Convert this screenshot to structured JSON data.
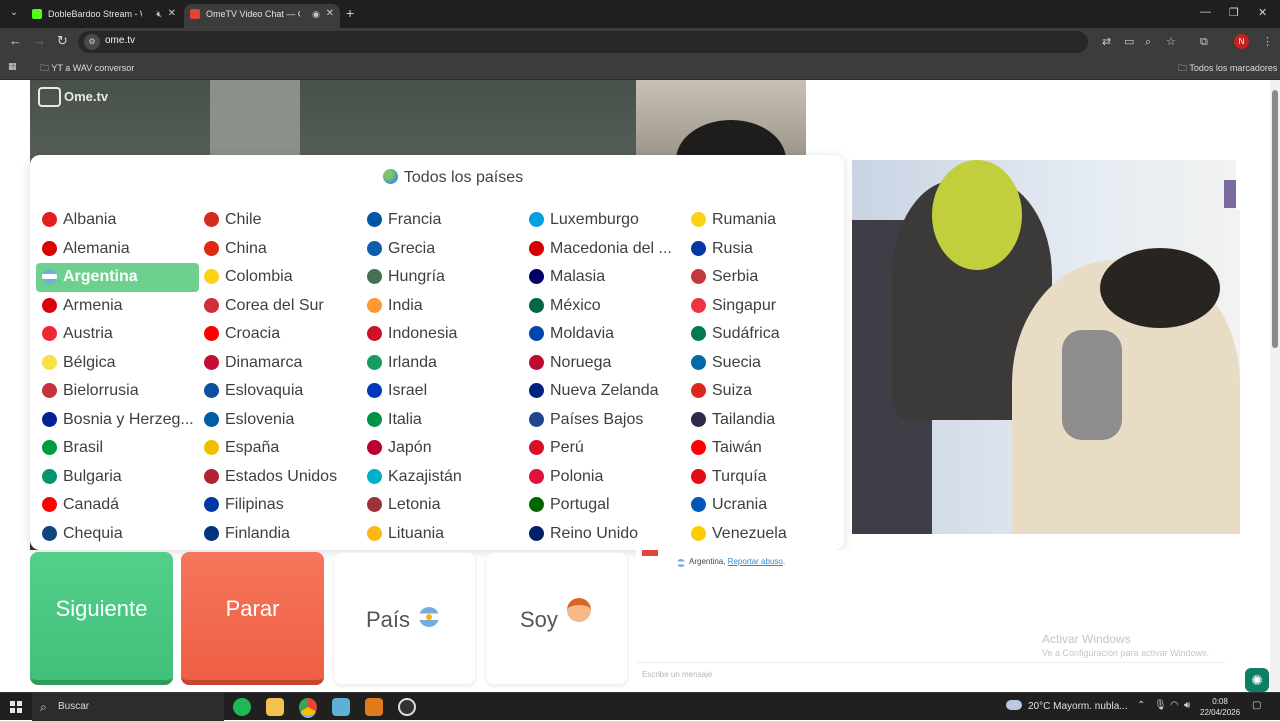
{
  "browser": {
    "tabs": [
      {
        "title": "DobleBardoo Stream - Watc",
        "favicon_color": "#53fc18",
        "muted_icon": "speaker-muted-icon"
      },
      {
        "title": "OmeTV Video Chat — Ome",
        "favicon_color": "#e0453a",
        "recording_icon": "record-icon"
      }
    ],
    "url": "ome.tv",
    "bookmarks": {
      "left": "YT a WAV conversor",
      "right": "Todos los marcadores"
    },
    "profile_initial": "N"
  },
  "page": {
    "logo": "Ome.tv",
    "dropdown_title": "Todos los países",
    "countries": [
      [
        {
          "name": "Albania",
          "flag": "#e41e20"
        },
        {
          "name": "Alemania",
          "flag": "#dd0000"
        },
        {
          "name": "Argentina",
          "flag": "#74acdf",
          "selected": true
        },
        {
          "name": "Armenia",
          "flag": "#d90012"
        },
        {
          "name": "Austria",
          "flag": "#ed2939"
        },
        {
          "name": "Bélgica",
          "flag": "#fae042"
        },
        {
          "name": "Bielorrusia",
          "flag": "#c8313e"
        },
        {
          "name": "Bosnia y Herzeg...",
          "flag": "#002395"
        },
        {
          "name": "Brasil",
          "flag": "#009c3b"
        },
        {
          "name": "Bulgaria",
          "flag": "#00966e"
        },
        {
          "name": "Canadá",
          "flag": "#ff0000"
        },
        {
          "name": "Chequia",
          "flag": "#11457e"
        }
      ],
      [
        {
          "name": "Chile",
          "flag": "#d52b1e"
        },
        {
          "name": "China",
          "flag": "#de2910"
        },
        {
          "name": "Colombia",
          "flag": "#fcd116"
        },
        {
          "name": "Corea del Sur",
          "flag": "#cd2e3a"
        },
        {
          "name": "Croacia",
          "flag": "#ff0000"
        },
        {
          "name": "Dinamarca",
          "flag": "#c60c30"
        },
        {
          "name": "Eslovaquia",
          "flag": "#0b4ea2"
        },
        {
          "name": "Eslovenia",
          "flag": "#005da4"
        },
        {
          "name": "España",
          "flag": "#f1bf00"
        },
        {
          "name": "Estados Unidos",
          "flag": "#b22234"
        },
        {
          "name": "Filipinas",
          "flag": "#0038a8"
        },
        {
          "name": "Finlandia",
          "flag": "#003580"
        }
      ],
      [
        {
          "name": "Francia",
          "flag": "#0055a4"
        },
        {
          "name": "Grecia",
          "flag": "#0d5eaf"
        },
        {
          "name": "Hungría",
          "flag": "#477050"
        },
        {
          "name": "India",
          "flag": "#ff9933"
        },
        {
          "name": "Indonesia",
          "flag": "#ce1126"
        },
        {
          "name": "Irlanda",
          "flag": "#169b62"
        },
        {
          "name": "Israel",
          "flag": "#0038b8"
        },
        {
          "name": "Italia",
          "flag": "#009246"
        },
        {
          "name": "Japón",
          "flag": "#bc002d"
        },
        {
          "name": "Kazajistán",
          "flag": "#00afca"
        },
        {
          "name": "Letonia",
          "flag": "#9e3039"
        },
        {
          "name": "Lituania",
          "flag": "#fdb913"
        }
      ],
      [
        {
          "name": "Luxemburgo",
          "flag": "#00a1de"
        },
        {
          "name": "Macedonia del ...",
          "flag": "#d20000"
        },
        {
          "name": "Malasia",
          "flag": "#010066"
        },
        {
          "name": "México",
          "flag": "#006847"
        },
        {
          "name": "Moldavia",
          "flag": "#0046ae"
        },
        {
          "name": "Noruega",
          "flag": "#ba0c2f"
        },
        {
          "name": "Nueva Zelanda",
          "flag": "#00247d"
        },
        {
          "name": "Países Bajos",
          "flag": "#21468b"
        },
        {
          "name": "Perú",
          "flag": "#d91023"
        },
        {
          "name": "Polonia",
          "flag": "#dc143c"
        },
        {
          "name": "Portugal",
          "flag": "#006600"
        },
        {
          "name": "Reino Unido",
          "flag": "#012169"
        }
      ],
      [
        {
          "name": "Rumania",
          "flag": "#fcd116"
        },
        {
          "name": "Rusia",
          "flag": "#0039a6"
        },
        {
          "name": "Serbia",
          "flag": "#c6363c"
        },
        {
          "name": "Singapur",
          "flag": "#ef3340"
        },
        {
          "name": "Sudáfrica",
          "flag": "#007a4d"
        },
        {
          "name": "Suecia",
          "flag": "#006aa7"
        },
        {
          "name": "Suiza",
          "flag": "#da291c"
        },
        {
          "name": "Tailandia",
          "flag": "#2d2a4a"
        },
        {
          "name": "Taiwán",
          "flag": "#fe0000"
        },
        {
          "name": "Turquía",
          "flag": "#e30a17"
        },
        {
          "name": "Ucrania",
          "flag": "#0057b7"
        },
        {
          "name": "Venezuela",
          "flag": "#ffcc00"
        }
      ]
    ],
    "buttons": {
      "next": "Siguiente",
      "stop": "Parar",
      "country": "País",
      "me": "Soy"
    },
    "chat": {
      "country": "Argentina,",
      "report": "Reportar abuso",
      "placeholder": "Escribe un mensaje"
    },
    "activate": {
      "line1": "Activar Windows",
      "line2": "Ve a Configuración para activar Windows."
    }
  },
  "taskbar": {
    "search": "Buscar",
    "weather": "20°C  Mayorm. nubla...",
    "time": "0:08",
    "date": "22/04/2026"
  }
}
